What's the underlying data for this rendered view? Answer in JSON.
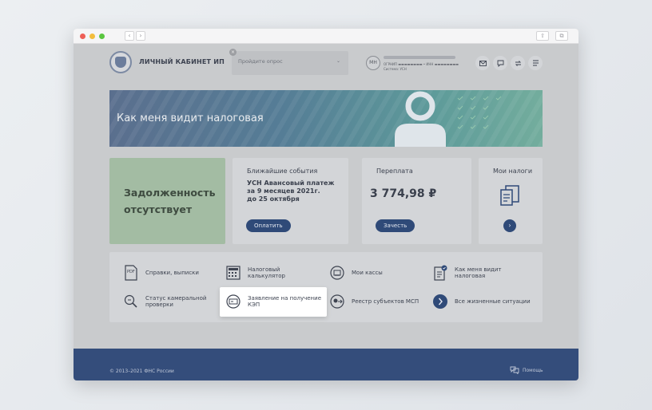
{
  "browser": {
    "back_glyph": "‹",
    "forward_glyph": "›",
    "share_glyph": "⇧",
    "tabs_glyph": "⧉"
  },
  "header": {
    "brand": "ЛИЧНЫЙ КАБИНЕТ ИП",
    "search_placeholder": "Пройдите опрос",
    "search_close": "×",
    "search_chevron": "⌄",
    "avatar_initials": "МН",
    "user_line2": "ОГРНИП ▬▬▬▬▬▬▬▬ • ИНН ▬▬▬▬▬▬▬▬",
    "user_line3": "Система: УСН",
    "icons": [
      "mail-icon",
      "chat-icon",
      "transfer-icon",
      "menu-icon"
    ]
  },
  "banner": {
    "title": "Как меня видит налоговая"
  },
  "cards": {
    "debt": {
      "line1": "Задолженность",
      "line2": "отсутствует"
    },
    "events": {
      "title": "Ближайшие события",
      "line1": "УСН Авансовый платеж",
      "line2": "за 9 месяцев 2021г.",
      "line3": "до 25 октября",
      "button": "Оплатить"
    },
    "overpay": {
      "title": "Переплата",
      "amount": "3 774,98 ₽",
      "button": "Зачесть"
    },
    "taxes": {
      "title": "Мои налоги",
      "arrow": "›"
    }
  },
  "services": [
    {
      "label1": "Справки, выписки",
      "label2": "",
      "icon": "pdf-document-icon"
    },
    {
      "label1": "Налоговый",
      "label2": "калькулятор",
      "icon": "calculator-icon"
    },
    {
      "label1": "Мои кассы",
      "label2": "",
      "icon": "cash-register-icon"
    },
    {
      "label1": "Как меня видит",
      "label2": "налоговая",
      "icon": "profile-check-icon"
    },
    {
      "label1": "Статус камеральной",
      "label2": "проверки",
      "icon": "search-status-icon"
    },
    {
      "label1": "Заявление на получение",
      "label2": "КЭП",
      "icon": "signature-card-icon"
    },
    {
      "label1": "Реестр субъектов МСП",
      "label2": "",
      "icon": "registry-icon"
    },
    {
      "label1": "Все жизненные ситуации",
      "label2": "",
      "icon": "arrow-circle-icon"
    }
  ],
  "footer": {
    "copyright": "© 2013–2021 ФНС России",
    "help": "Помощь"
  },
  "colors": {
    "accent": "#2f4a78",
    "footer": "#344d7b",
    "debt_card": "#a3bca3"
  }
}
